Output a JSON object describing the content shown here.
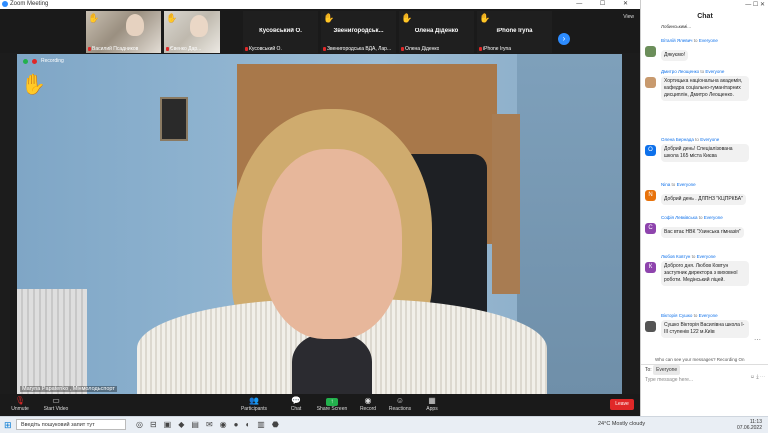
{
  "window": {
    "title": "Zoom Meeting",
    "controls": "— ☐ ✕"
  },
  "gallery": {
    "tiles": [
      {
        "name": "",
        "label": "Василий Псадников"
      },
      {
        "name": "",
        "label": "Євенко Дар..."
      },
      {
        "name": "Кусовський О.",
        "label": "Кусовський О."
      },
      {
        "name": "Звенигородськ...",
        "label": "Звенигородська ВДА, Лар..."
      },
      {
        "name": "Олена Діденко",
        "label": "Олена Діденко"
      },
      {
        "name": "iPhone Iryna",
        "label": "iPhone Iryna"
      }
    ],
    "view_label": "View",
    "next_icon": "chevron-right-icon"
  },
  "main_video": {
    "recording_label": "Recording",
    "speaker_label": "Maryna Papatenko , Мінмолодьспорт"
  },
  "toolbar": {
    "unmute": "Unmute",
    "start_video": "Start Video",
    "participants": "Participants",
    "participants_count": "72",
    "chat": "Chat",
    "share_screen": "Share Screen",
    "record": "Record",
    "reactions": "Reactions",
    "apps": "Apps",
    "leave": "Leave"
  },
  "chat": {
    "header_ctrl": "— ☐ ✕",
    "title": "Chat",
    "top_message": "Лобинськимі...",
    "messages": [
      {
        "from": "Віталій Ялевич",
        "to": "Everyone",
        "text": "Дякуємо!",
        "initial": "",
        "color": "#6b8e5a"
      },
      {
        "from": "Дмитро Леощенко",
        "to": "Everyone",
        "text": "Хортицька національна академія, кафедра соціально-гуманітарних дисциплін, Дмитро Леощенко.",
        "initial": "",
        "color": "#c89a6e"
      },
      {
        "from": "Олена Бернада",
        "to": "Everyone",
        "text": "Добрий день! Спеціалізована школа 165 міста Києва",
        "initial": "О",
        "color": "#0e71eb"
      },
      {
        "from": "Nina",
        "to": "Everyone",
        "text": "Добрий день . ДЛПНЗ \"КЦПРКБА\"",
        "initial": "N",
        "color": "#e8730c"
      },
      {
        "from": "Софія Левківська",
        "to": "Everyone",
        "text": "Вас втає НВК \"Узинська гімназія\"",
        "initial": "С",
        "color": "#8e44ad"
      },
      {
        "from": "Любов Ковтун",
        "to": "Everyone",
        "text": "Доброго дня. Любов Ковтун заступник директора з виховної роботи. Медінський ліцей.",
        "initial": "К",
        "color": "#8e44ad"
      },
      {
        "from": "Вікторія Сушко",
        "to": "Everyone",
        "text": "Сушко Вікторія Василівна школа І-ІІІ ступенів 122 м.Київ",
        "initial": "",
        "color": "#555555"
      }
    ],
    "warning": "Who can see your messages? Recording On",
    "to_label": "To:",
    "to_value": "Everyone",
    "placeholder": "Type message here..."
  },
  "taskbar": {
    "search_placeholder": "Введіть пошуковий запит тут",
    "weather": "24°C  Mostly cloudy",
    "lang": "УКР",
    "time": "11:13",
    "date": "07.06.2022"
  }
}
